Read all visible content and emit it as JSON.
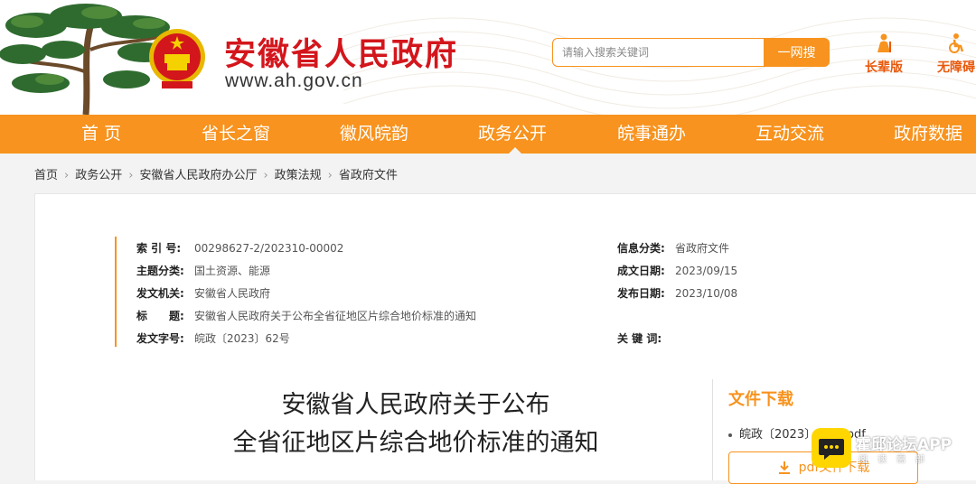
{
  "header": {
    "site_title": "安徽省人民政府",
    "site_url": "www.ah.gov.cn",
    "search_placeholder": "请输入搜索关键词",
    "search_button": "一网搜",
    "tools": [
      {
        "label": "长辈版",
        "icon": "elder-icon"
      },
      {
        "label": "无障碍",
        "icon": "accessibility-icon"
      }
    ],
    "colors": {
      "brand_red": "#d3161c",
      "accent_orange": "#f7931e"
    }
  },
  "nav": {
    "items": [
      "首 页",
      "省长之窗",
      "徽风皖韵",
      "政务公开",
      "皖事通办",
      "互动交流",
      "政府数据"
    ],
    "active": "政务公开"
  },
  "breadcrumb": [
    "首页",
    "政务公开",
    "安徽省人民政府办公厅",
    "政策法规",
    "省政府文件"
  ],
  "meta": {
    "index_no": {
      "key": "索 引 号:",
      "value": "00298627-2/202310-00002"
    },
    "topic": {
      "key": "主题分类:",
      "value": "国土资源、能源"
    },
    "issuer": {
      "key": "发文机关:",
      "value": "安徽省人民政府"
    },
    "title": {
      "key": "标　　题:",
      "value": "安徽省人民政府关于公布全省征地区片综合地价标准的通知"
    },
    "doc_no": {
      "key": "发文字号:",
      "value": "皖政〔2023〕62号"
    },
    "info_category": {
      "key": "信息分类:",
      "value": "省政府文件"
    },
    "created": {
      "key": "成文日期:",
      "value": "2023/09/15"
    },
    "published": {
      "key": "发布日期:",
      "value": "2023/10/08"
    },
    "keywords": {
      "key": "关 键 词:",
      "value": ""
    }
  },
  "document": {
    "title_line1": "安徽省人民政府关于公布",
    "title_line2": "全省征地区片综合地价标准的通知"
  },
  "download": {
    "heading": "文件下载",
    "file_name": "皖政〔2023〕62号.pdf",
    "button": "pdf文件下载"
  },
  "watermark": {
    "text": "霍邱论坛APP",
    "sub": "阅读需部"
  }
}
